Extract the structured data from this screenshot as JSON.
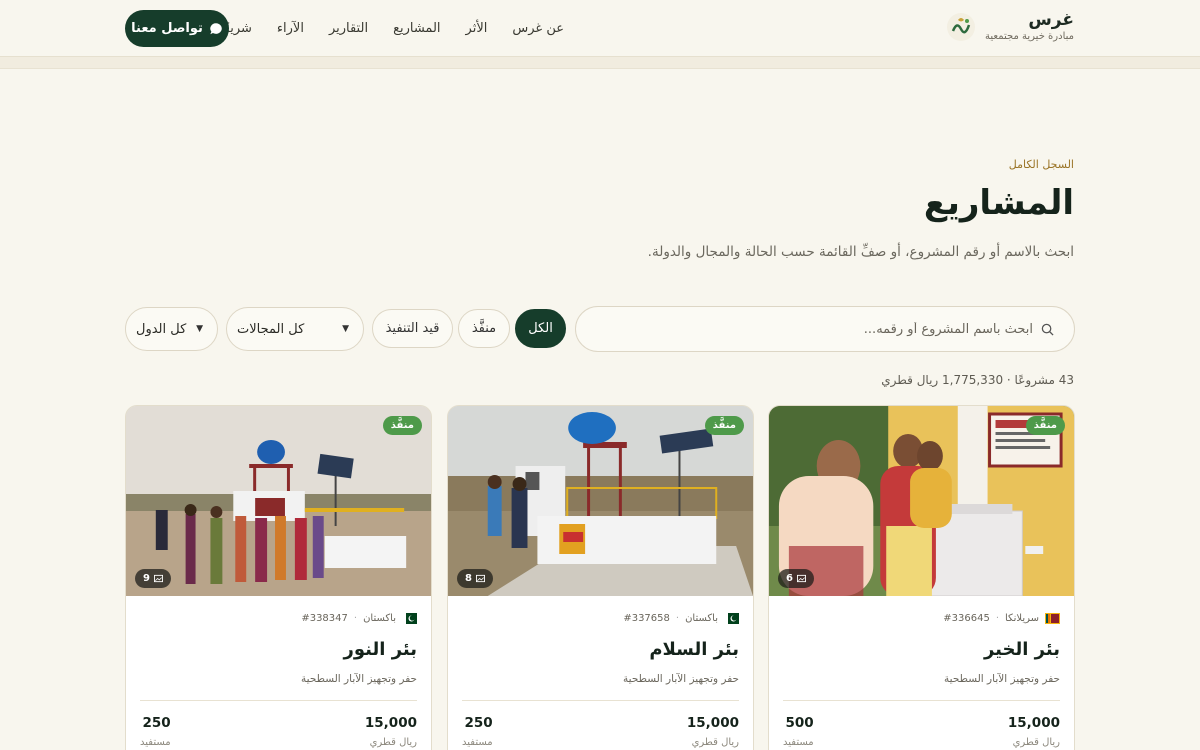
{
  "brand": {
    "name": "غرس",
    "tagline": "مبادرة خيرية مجتمعية"
  },
  "nav": {
    "items": [
      "عن غرس",
      "الأثر",
      "المشاريع",
      "التقارير",
      "الآراء",
      "شريكنا"
    ]
  },
  "contact_button": "تواصل معنا",
  "hero": {
    "eyebrow": "السجل الكامل",
    "title": "المشاريع",
    "subtitle": "ابحث بالاسم أو رقم المشروع، أو صفِّ القائمة حسب الحالة والمجال والدولة."
  },
  "filters": {
    "search_placeholder": "ابحث باسم المشروع أو رقمه...",
    "status_tabs": [
      "الكل",
      "منفَّذ",
      "قيد التنفيذ"
    ],
    "active_status": "الكل",
    "field_select": "كل المجالات",
    "country_select": "كل الدول"
  },
  "summary": "43 مشروعًا · 1,775,330 ريال قطري",
  "projects": [
    {
      "badge": "منفَّذ",
      "photo_count": "6",
      "country": "سريلانكا",
      "flag": "sri-lanka-flag",
      "number": "#336645",
      "title": "بئر الخير",
      "description": "حفر وتجهيز الآبار السطحية",
      "cost": "15,000",
      "beneficiaries": "500",
      "cost_label": "ريال قطري",
      "beneficiaries_label": "مستفيد"
    },
    {
      "badge": "منفَّذ",
      "photo_count": "8",
      "country": "باكستان",
      "flag": "pakistan-flag",
      "number": "#337658",
      "title": "بئر السلام",
      "description": "حفر وتجهيز الآبار السطحية",
      "cost": "15,000",
      "beneficiaries": "250",
      "cost_label": "ريال قطري",
      "beneficiaries_label": "مستفيد"
    },
    {
      "badge": "منفَّذ",
      "photo_count": "9",
      "country": "باكستان",
      "flag": "pakistan-flag",
      "number": "#338347",
      "title": "بئر النور",
      "description": "حفر وتجهيز الآبار السطحية",
      "cost": "15,000",
      "beneficiaries": "250",
      "cost_label": "ريال قطري",
      "beneficiaries_label": "مستفيد"
    }
  ],
  "colors": {
    "primary": "#163d2b",
    "accent": "#9a7426",
    "badge": "#4e9a4a",
    "background": "#f8f6ee"
  }
}
